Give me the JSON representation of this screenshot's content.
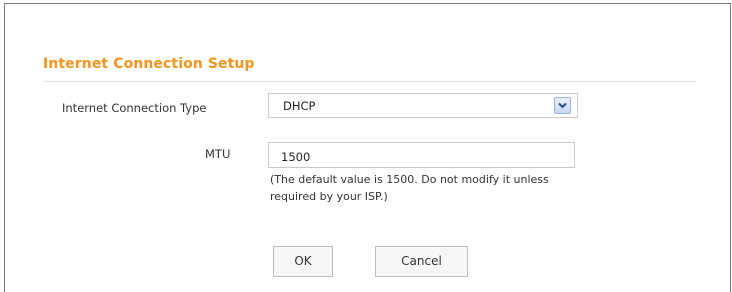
{
  "section": {
    "title": "Internet Connection Setup"
  },
  "connection_type": {
    "label": "Internet Connection Type",
    "selected": "DHCP"
  },
  "mtu": {
    "label": "MTU",
    "value": "1500",
    "hint_line1": "(The default value is 1500. Do not modify it unless",
    "hint_line2": "required by your ISP.)"
  },
  "buttons": {
    "ok": "OK",
    "cancel": "Cancel"
  },
  "colors": {
    "title": "#f7941d",
    "arrow_button": "#c7d7f0"
  },
  "icons": {
    "dropdown": "chevron-down-icon"
  }
}
